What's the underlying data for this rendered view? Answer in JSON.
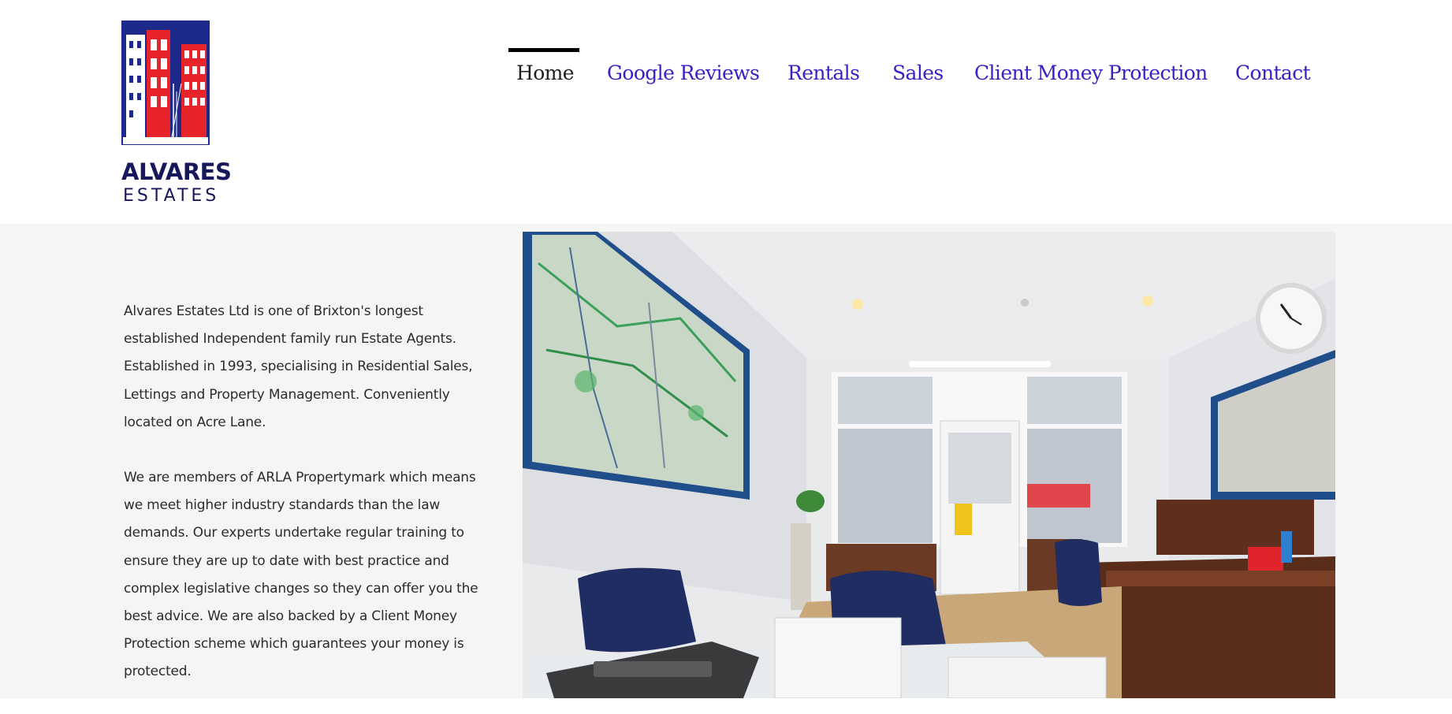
{
  "brand": {
    "name_line1": "ALVARES",
    "name_line2": "ESTATES",
    "colors": {
      "navy": "#17185c",
      "red": "#e8242b",
      "blue": "#1d2a8c"
    }
  },
  "nav": {
    "items": [
      {
        "label": "Home",
        "active": true
      },
      {
        "label": "Google Reviews",
        "active": false
      },
      {
        "label": "Rentals",
        "active": false
      },
      {
        "label": "Sales",
        "active": false
      },
      {
        "label": "Client Money Protection",
        "active": false
      },
      {
        "label": "Contact",
        "active": false
      }
    ],
    "link_color": "#3b20c8",
    "active_color": "#1f1f1f"
  },
  "main": {
    "paragraphs": [
      "Alvares Estates Ltd is one of Brixton's longest established Independent family run Estate Agents. Established in 1993, specialising in Residential Sales, Lettings and Property Management. Conveniently located on Acre Lane.",
      "We are members of ARLA Propertymark which means we meet higher industry standards than the law demands. Our experts undertake regular training to ensure they are up to date with best practice and complex legislative changes so they can offer you the best advice. We are also backed by a Client Money Protection scheme which guarantees your money is protected."
    ]
  }
}
